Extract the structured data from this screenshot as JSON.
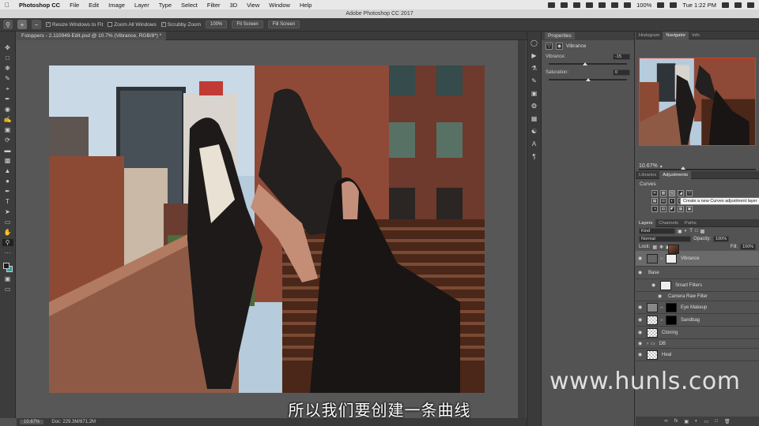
{
  "menubar": {
    "app": "Photoshop CC",
    "items": [
      "File",
      "Edit",
      "Image",
      "Layer",
      "Type",
      "Select",
      "Filter",
      "3D",
      "View",
      "Window",
      "Help"
    ],
    "battery": "100%",
    "clock": "Tue 1:22 PM"
  },
  "window_title": "Adobe Photoshop CC 2017",
  "options": {
    "resize_windows": "Resize Windows to Fit",
    "zoom_all": "Zoom All Windows",
    "scrubby": "Scrubby Zoom",
    "pct_btn": "100%",
    "fit_btn": "Fit Screen",
    "fill_btn": "Fill Screen"
  },
  "document": {
    "tab": "Fstoppers - 2.110949-Edit.psd @ 10.7% (Vibrance, RGB/8*) *",
    "zoom": "10.67%",
    "doc_size": "Doc: 229.3M/871.2M"
  },
  "properties": {
    "tab": "Properties",
    "layer_type": "Vibrance",
    "vibrance_label": "Vibrance:",
    "vibrance_value": "-15",
    "vibrance_fraction": 0.46,
    "saturation_label": "Saturation:",
    "saturation_value": "0",
    "saturation_fraction": 0.5
  },
  "navigator": {
    "tabs": [
      "Histogram",
      "Navigator",
      "Info"
    ],
    "active": "Navigator",
    "zoom": "10.67%",
    "zoom_fraction": 0.38
  },
  "adjustments": {
    "tabs": [
      "Libraries",
      "Adjustments"
    ],
    "heading": "Curves",
    "tooltip": "Create a new Curves adjustment layer"
  },
  "layers": {
    "tabs": [
      "Layers",
      "Channels",
      "Paths"
    ],
    "filter": "Kind",
    "blend": "Normal",
    "opacity_label": "Opacity:",
    "opacity": "100%",
    "lock_label": "Lock:",
    "fill_label": "Fill:",
    "fill": "100%",
    "items": [
      {
        "name": "Vibrance",
        "selected": true
      },
      {
        "name": "Base"
      },
      {
        "name": "Smart Filters"
      },
      {
        "name": "Camera Raw Filter"
      },
      {
        "name": "Eye Makeup"
      },
      {
        "name": "Sandbag"
      },
      {
        "name": "Cloning"
      },
      {
        "name": "DB"
      },
      {
        "name": "Heal"
      }
    ]
  },
  "subtitle": "所以我们要创建一条曲线",
  "watermark": "www.hunls.com"
}
